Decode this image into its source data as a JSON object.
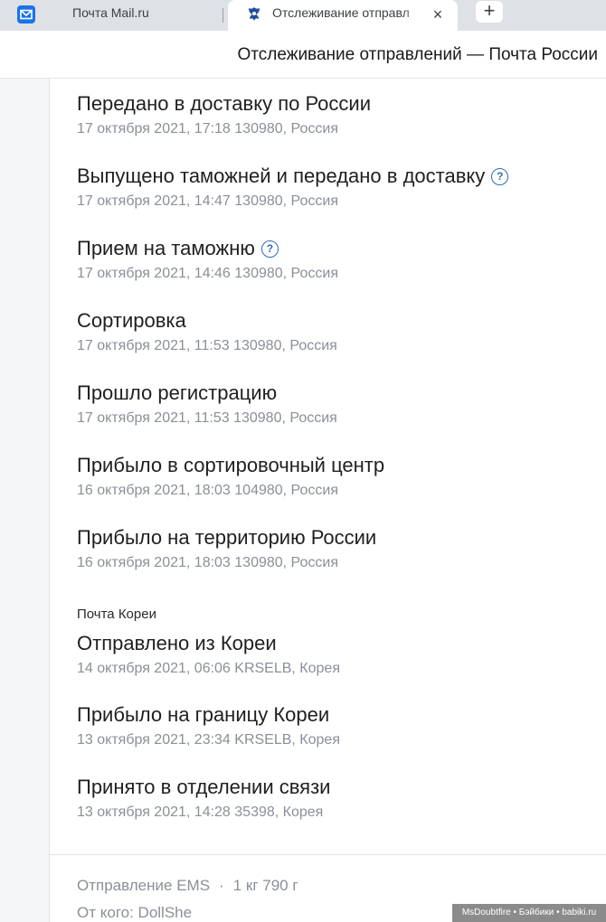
{
  "browser": {
    "tabs": [
      {
        "label": "Почта Mail.ru",
        "icon": "mail-icon"
      },
      {
        "label": "Отслеживание отправл",
        "icon": "russian-post-crest-icon",
        "active": true
      }
    ],
    "close_icon": "×",
    "new_tab_icon": "+"
  },
  "page": {
    "title": "Отслеживание отправлений — Почта России"
  },
  "events": [
    {
      "title": "Передано в доставку по России",
      "meta": "17 октября 2021, 17:18 130980, Россия"
    },
    {
      "title": "Выпущено таможней и передано в доставку",
      "meta": "17 октября 2021, 14:47 130980, Россия",
      "help": "?"
    },
    {
      "title": "Прием на таможню",
      "meta": "17 октября 2021, 14:46 130980, Россия",
      "help": "?"
    },
    {
      "title": "Сортировка",
      "meta": "17 октября 2021, 11:53 130980, Россия"
    },
    {
      "title": "Прошло регистрацию",
      "meta": "17 октября 2021, 11:53 130980, Россия"
    },
    {
      "title": "Прибыло в сортировочный центр",
      "meta": "16 октября 2021, 18:03 104980, Россия"
    },
    {
      "title": "Прибыло на территорию России",
      "meta": "16 октября 2021, 18:03 130980, Россия"
    },
    {
      "title": "Отправлено из Кореи",
      "meta": "14 октября 2021, 06:06 KRSELB, Корея"
    },
    {
      "title": "Прибыло на границу Кореи",
      "meta": "13 октября 2021, 23:34 KRSELB, Корея"
    },
    {
      "title": "Принято в отделении связи",
      "meta": "13 октября 2021, 14:28 35398, Корея"
    }
  ],
  "section_korea": "Почта Кореи",
  "footer": {
    "shipment_type": "Отправление EMS",
    "separator": "·",
    "weight": "1 кг 790 г",
    "sender": "От кого: DollShe"
  },
  "watermark": "MsDoubtfire • Бэйбики • babiki.ru",
  "colors": {
    "help_icon": "#2f6cb5",
    "meta_text": "#8a8f98",
    "mail_icon": "#1a73e8",
    "crest": "#1f4e9c"
  }
}
